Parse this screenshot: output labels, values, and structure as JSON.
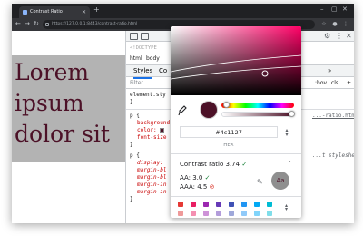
{
  "browser": {
    "tab_title": "Contrast Ratio",
    "url": "https://127.0.0.1:8443/contrast-ratio.html"
  },
  "page": {
    "lorem_text": "Lorem ipsum dolor sit",
    "text_color": "#4c1127",
    "background_color": "#b3b3b3"
  },
  "devtools": {
    "doctype": "<!DOCTYPE",
    "breadcrumbs": [
      "html",
      "body"
    ],
    "subtabs": [
      "Styles",
      "Co"
    ],
    "subtabs_more": "»",
    "filter_placeholder": "Filter",
    "filter_right": [
      ":hov",
      ".cls",
      "+"
    ],
    "element_style": "element.sty",
    "rule1_selector": "p {",
    "rule1_props": [
      "background",
      "color:",
      "font-size"
    ],
    "rule1_close": "}",
    "rule1_source": "...-ratio.html:8",
    "rule2_selector": "p {",
    "rule2_props": [
      "display:",
      "margin-bl",
      "margin-bl",
      "margin-in",
      "margin-in"
    ],
    "rule2_close": "}",
    "rule2_source": "...t stylesheet"
  },
  "picker": {
    "hex_value": "#4c1127",
    "format_label": "HEX",
    "contrast_label": "Contrast ratio 3.74",
    "contrast_ok": "✓",
    "aa_label": "AA: 3.0",
    "aa_ok": "✓",
    "aaa_label": "AAA: 4.5",
    "aaa_fail": "⊘",
    "preview_text": "Aa",
    "hue_level": 0.03,
    "alpha_level": 1.0,
    "palette": [
      "#e53935",
      "#e91e63",
      "#9c27b0",
      "#673ab7",
      "#3f51b5",
      "#2196f3",
      "#03a9f4",
      "#00bcd4"
    ],
    "palette_row2": [
      "#ef9a9a",
      "#f48fb1",
      "#ce93d8",
      "#b39ddb",
      "#9fa8da",
      "#90caf9",
      "#81d4fa",
      "#80deea"
    ]
  }
}
